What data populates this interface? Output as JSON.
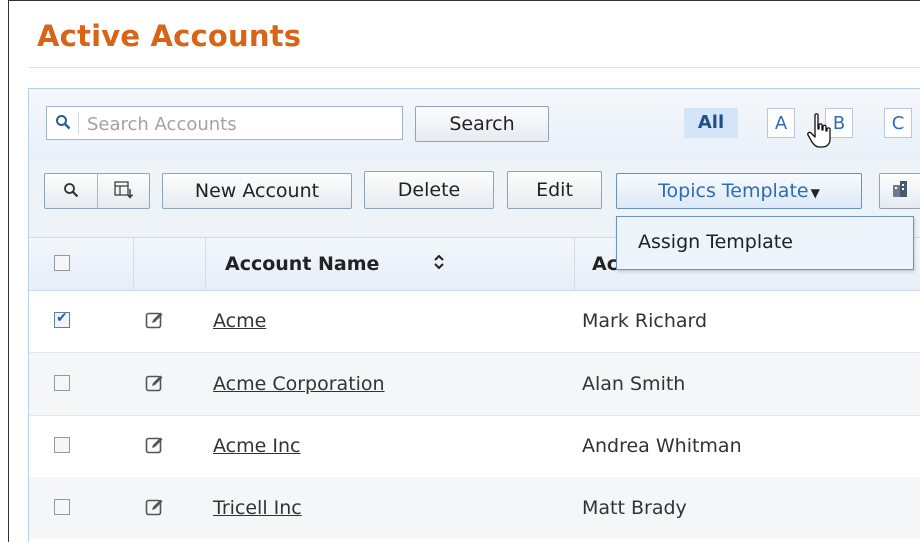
{
  "page": {
    "title": "Active Accounts"
  },
  "search": {
    "placeholder": "Search Accounts",
    "value": "",
    "button_label": "Search"
  },
  "alpha_filter": {
    "letters": [
      "All",
      "A",
      "B",
      "C"
    ],
    "selected": "All"
  },
  "toolbar": {
    "new_label": "New Account",
    "delete_label": "Delete",
    "edit_label": "Edit",
    "topics_label": "Topics Template",
    "topics_caret": "▼"
  },
  "dropdown": {
    "items": [
      "Assign Template"
    ]
  },
  "table": {
    "columns": [
      "",
      "",
      "Account Name",
      "Ac"
    ],
    "sort_icon": "chevrons-up-down",
    "rows": [
      {
        "checked": true,
        "name": "Acme",
        "owner": "Mark Richard"
      },
      {
        "checked": false,
        "name": "Acme Corporation",
        "owner": "Alan Smith"
      },
      {
        "checked": false,
        "name": "Acme Inc",
        "owner": "Andrea Whitman"
      },
      {
        "checked": false,
        "name": "Tricell Inc",
        "owner": "Matt Brady"
      }
    ]
  },
  "colors": {
    "title": "#d86418",
    "link": "#2f6db3",
    "accent": "#6b92bc"
  }
}
